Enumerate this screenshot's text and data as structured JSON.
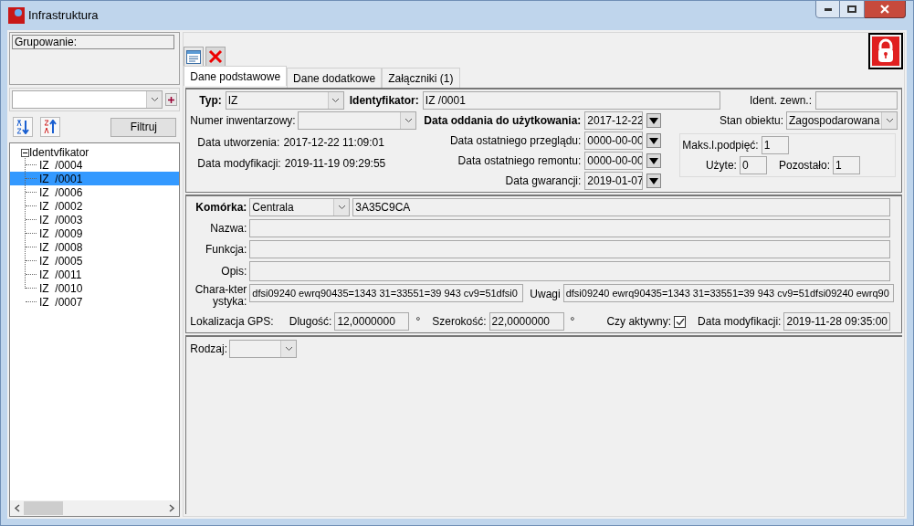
{
  "window": {
    "title": "Infrastruktura"
  },
  "sidebar": {
    "grouping_label": "Grupowanie:",
    "filter_button": "Filtruj",
    "tree": {
      "label": "Identvfikator",
      "expanded": true,
      "children": [
        {
          "label": "IZ  /0004",
          "selected": false
        },
        {
          "label": "IZ  /0001",
          "selected": true
        },
        {
          "label": "IZ  /0006",
          "selected": false
        },
        {
          "label": "IZ  /0002",
          "selected": false
        },
        {
          "label": "IZ  /0003",
          "selected": false
        },
        {
          "label": "IZ  /0009",
          "selected": false
        },
        {
          "label": "IZ  /0008",
          "selected": false
        },
        {
          "label": "IZ  /0005",
          "selected": false
        },
        {
          "label": "IZ  /0011",
          "selected": false
        },
        {
          "label": "IZ  /0010",
          "selected": false
        },
        {
          "label": "IZ  /0007",
          "selected": false
        }
      ]
    }
  },
  "tabs": [
    {
      "label": "Dane podstawowe",
      "selected": true
    },
    {
      "label": "Dane dodatkowe",
      "selected": false
    },
    {
      "label": "Załączniki (1)",
      "selected": false
    }
  ],
  "basic": {
    "type": {
      "label": "Typ:",
      "value": "IZ"
    },
    "identifier": {
      "label": "Identyfikator:",
      "value": "IZ  /0001"
    },
    "external_id": {
      "label": "Ident. zewn.:"
    },
    "inventory_number": {
      "label": "Numer inwentarzowy:"
    },
    "commissioning_date": {
      "label": "Data oddania do użytkowania:",
      "value": "2017-12-22"
    },
    "object_state": {
      "label": "Stan obiektu:",
      "value": "Zagospodarowana"
    },
    "created": {
      "label": "Data utworzenia:",
      "value": "2017-12-22 11:09:01"
    },
    "modified": {
      "label": "Data modyfikacji:",
      "value": "2019-11-19 09:29:55"
    },
    "last_inspection": {
      "label": "Data ostatniego przeglądu:",
      "value": "0000-00-00"
    },
    "last_repair": {
      "label": "Data ostatniego remontu:",
      "value": "0000-00-00"
    },
    "warranty": {
      "label": "Data gwarancji:",
      "value": "2019-01-07"
    },
    "max_connections": {
      "label": "Maks.l.podpięć:",
      "value": "1"
    },
    "used": {
      "label": "Użyte:",
      "value": "0"
    },
    "remaining": {
      "label": "Pozostało:",
      "value": "1"
    }
  },
  "cell": {
    "label": "Komórka:",
    "value": "Centrala",
    "code": "3A35C9CA",
    "name_label": "Nazwa:",
    "function_label": "Funkcja:",
    "description_label": "Opis:",
    "characteristics": {
      "label": "Chara-kterystyka:",
      "value": "dfsi09240 ewrq90435=1343 31=33551=39 943 cv9=51dfsi0"
    },
    "notes": {
      "label": "Uwagi",
      "value": "dfsi09240 ewrq90435=1343 31=33551=39 943 cv9=51dfsi09240 ewrq90"
    },
    "gps": {
      "label": "Lokalizacja GPS:",
      "longitude_label": "Dlugość:",
      "longitude": "12,0000000",
      "latitude_label": "Szerokość:",
      "latitude": "22,0000000",
      "unit": "°"
    },
    "active": {
      "label": "Czy aktywny:",
      "checked": true
    },
    "modified": {
      "label": "Data modyfikacji:",
      "value": "2019-11-28 09:35:00"
    }
  },
  "kind_field": {
    "label": "Rodzaj:"
  }
}
